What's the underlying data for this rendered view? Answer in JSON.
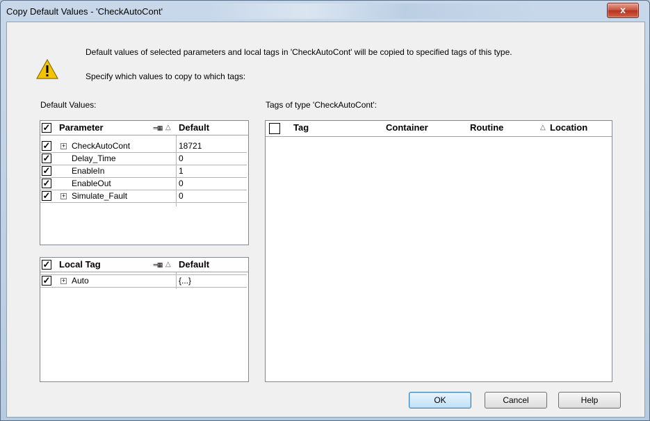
{
  "window": {
    "title": "Copy Default Values - 'CheckAutoCont'",
    "close_label": "x"
  },
  "message": {
    "line1": "Default values of selected parameters and local tags in 'CheckAutoCont' will be copied to specified tags of this type.",
    "line2": "Specify which values to copy to which tags:"
  },
  "default_values": {
    "label": "Default Values:",
    "parameters": {
      "headers": {
        "name": "Parameter",
        "default": "Default"
      },
      "rows": [
        {
          "name": "CheckAutoCont",
          "value": "18721"
        },
        {
          "name": "Delay_Time",
          "value": "0"
        },
        {
          "name": "EnableIn",
          "value": "1"
        },
        {
          "name": "EnableOut",
          "value": "0"
        },
        {
          "name": "Simulate_Fault",
          "value": "0"
        }
      ]
    },
    "local_tags": {
      "headers": {
        "name": "Local Tag",
        "default": "Default"
      },
      "rows": [
        {
          "name": "Auto",
          "value": "{...}"
        }
      ]
    }
  },
  "tags": {
    "label": "Tags of type 'CheckAutoCont':",
    "headers": {
      "tag": "Tag",
      "container": "Container",
      "routine": "Routine",
      "location": "Location"
    }
  },
  "buttons": {
    "ok": "OK",
    "cancel": "Cancel",
    "help": "Help"
  },
  "colors": {
    "accent": "#3c7fb1",
    "close": "#c8513c",
    "warning": "#f5c400"
  }
}
